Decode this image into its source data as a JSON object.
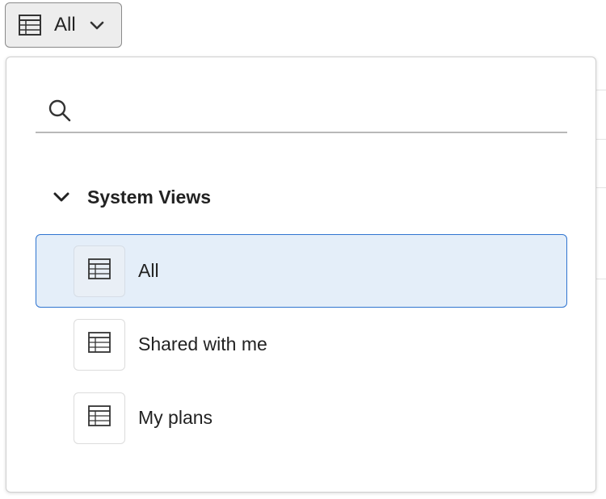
{
  "trigger": {
    "label": "All",
    "icon": "table-icon",
    "chevron": "chevron-down-icon"
  },
  "search": {
    "placeholder": "",
    "value": "",
    "icon": "search-icon"
  },
  "section": {
    "title": "System Views",
    "expanded": true,
    "icon": "chevron-down-icon"
  },
  "views": [
    {
      "label": "All",
      "icon": "table-icon",
      "selected": true
    },
    {
      "label": "Shared with me",
      "icon": "table-icon",
      "selected": false
    },
    {
      "label": "My plans",
      "icon": "table-icon",
      "selected": false
    }
  ],
  "colors": {
    "selected_background": "#e4eef9",
    "selected_border": "#2f74d0",
    "trigger_background": "#ededed"
  }
}
